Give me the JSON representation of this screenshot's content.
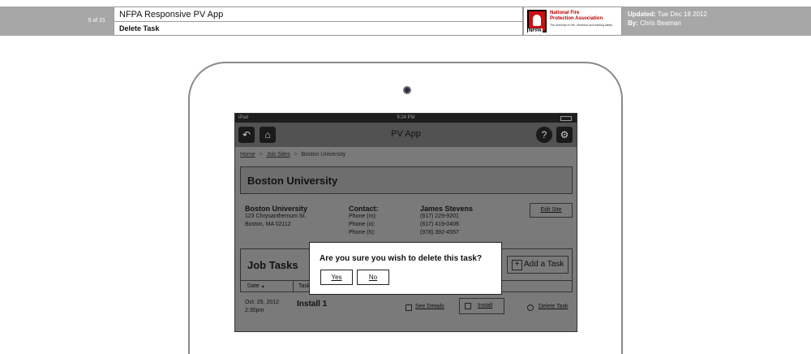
{
  "header": {
    "page_counter": "5 of 21",
    "title": "NFPA Responsive PV App",
    "subtitle": "Delete Task",
    "logo": {
      "icon": "nfpa-flame-logo",
      "mark_text": "NFPA",
      "org_line1": "National Fire",
      "org_line2": "Protection Association",
      "tagline": "The authority on fire, electrical and building safety"
    },
    "updated_label": "Updated:",
    "updated_value": "Tue Dec 18 2012",
    "by_label": "By:",
    "by_value": "Chris Beaman"
  },
  "device": {
    "status": {
      "carrier": "iPad",
      "time": "9:24 PM"
    },
    "nav": {
      "title": "PV App",
      "back_icon": "back-arrow-icon",
      "home_icon": "home-icon",
      "help_icon": "help-icon",
      "settings_icon": "gear-icon"
    },
    "breadcrumb": {
      "home": "Home",
      "job_sites": "Job Sites",
      "current": "Boston University",
      "separator": ">"
    },
    "site_title": "Boston University",
    "site": {
      "name": "Boston University",
      "street": "123 Chrysanthemum St.",
      "city": "Boston, MA 02112"
    },
    "contact": {
      "label": "Contact:",
      "name": "James Stevens",
      "phone_m_label": "Phone (m):",
      "phone_m": "(617) 229-9201",
      "phone_o_label": "Phone (o):",
      "phone_o": "(617) 419-0406",
      "phone_h_label": "Phone (h):",
      "phone_h": "(978) 392-4557"
    },
    "edit_site": "Edit Site",
    "jobs": {
      "title": "Job Tasks",
      "add_task": "Add a Task",
      "col_date": "Date",
      "sort_indicator": "▲",
      "col_task": "Task",
      "rows": [
        {
          "date": "Oct. 25, 2012",
          "time": "2:30pm",
          "task": "Install 1",
          "see_details": "See Details",
          "install": "Install",
          "delete": "Delete Task"
        }
      ]
    }
  },
  "dialog": {
    "question": "Are you sure you wish to delete this task?",
    "yes": "Yes",
    "no": "No"
  }
}
